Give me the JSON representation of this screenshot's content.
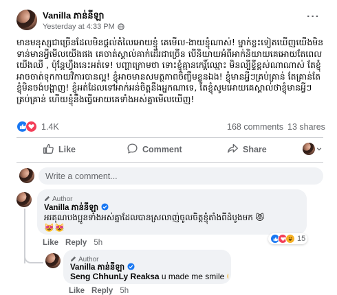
{
  "post": {
    "author": "Vanilla ភាន់នីឡា",
    "timestamp": "Yesterday at 4:33 PM",
    "more_label": "···",
    "text": "មានមនុស្សជាច្រើនដែលមិនផ្តល់តំលៃអោយខ្ញុំ គេមើល-ងាយខ្ញុំណាស់! ម្នាក់ខ្លះទៀតឃើញយើងមិនទាន់មានអ្វីមើលយើងផង គេចាត់ស្គាល់គាក់ដើរជាច្រើន បើនិយាយអំពីអាក់និយាយគេអោយតែពេលយើងឈឺ , ប៉ុន្តែហ្វឹងនេះអត់ទេ! បញ្ហាក្រោមថា ទោះខ្ញុំគ្មានកេរ្តិ៍ឈ្មោះ មិនល្បីខ្ទីខ្ពស់ណាណាស់ តែខ្ញុំអាចចាត់ទុកកាយវិការបានល្អ! ខ្ញុំអាចមានសមត្ថភាពចិញ្ចឹមខ្លួនឯង! ខ្ញុំមានអ្វីៗគ្រប់គ្រាន់ តែគ្រាន់តែខ្ញុំមិនចង់បង្ហាញ! ខ្ញុំអត់ដែលទៅអាក់អន់ចិត្តនឹងអ្នកណាទេ, តែខ្ញុំសូមអោយគេស្គាល់ថាខ្ញុំមានអ្វីៗគ្រប់គ្រាន់ ហើយខ្ញុំនឹងធ្វើអោយគេទាំងអស់គ្នាមើលឃើញ!",
    "reaction_count": "1.4K",
    "comments_count": "168 comments",
    "shares_count": "13 shares"
  },
  "actions": {
    "like": "Like",
    "comment": "Comment",
    "share": "Share"
  },
  "composer": {
    "placeholder": "Write a comment..."
  },
  "comment1": {
    "badge": "Author",
    "author": "Vanilla ភាន់នីឡា",
    "text": "អរគុណបងប្អូនទាំងអស់គ្នាដែលបានស្រលាញ់ចូលចិត្តខ្ញុំតាំងពីដំបូងមក 😻",
    "emoji_line": "😻😻",
    "like": "Like",
    "reply": "Reply",
    "time": "5h",
    "reaction_count": "15"
  },
  "comment2": {
    "badge": "Author",
    "author": "Vanilla ភាន់នីឡា",
    "mention": "Seng ChhunLy Reaksa",
    "text": " u made me smile 😊",
    "like": "Like",
    "reply": "Reply",
    "time": "5h"
  },
  "colors": {
    "like_blue": "#1877f2",
    "love_red": "#f33e58",
    "haha_yellow": "#f7b125"
  }
}
